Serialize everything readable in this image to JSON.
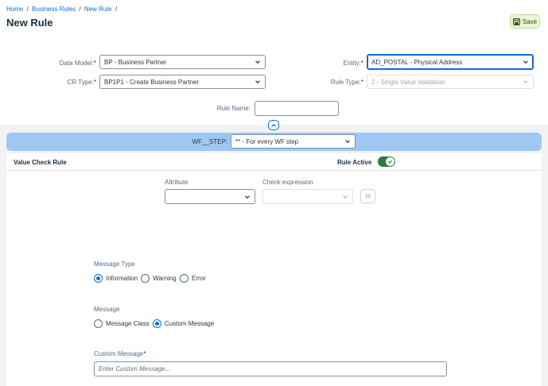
{
  "breadcrumb": {
    "home": "Home",
    "business_rules": "Business Rules",
    "new_rule": "New Rule",
    "sep": "/"
  },
  "page": {
    "title": "New Rule",
    "save_label": "Save"
  },
  "form": {
    "data_model": {
      "label": "Data Model:",
      "value": "BP - Business Partner"
    },
    "cr_type": {
      "label": "CR Type:",
      "value": "BP1P1 - Create Business Partner"
    },
    "entity": {
      "label": "Entity:",
      "value": "AD_POSTAL - Physical Address"
    },
    "rule_type": {
      "label": "Rule Type:",
      "value": "2 - Single Value Validation"
    },
    "rule_name": {
      "label": "Rule Name:",
      "value": ""
    },
    "required_mark": "*"
  },
  "wf_step": {
    "label": "WF__STEP:",
    "value": "** - For every WF step"
  },
  "rule_panel": {
    "title": "Value Check Rule",
    "rule_active_label": "Rule Active",
    "rule_active": true,
    "attribute_label": "Attribute",
    "attribute_value": "",
    "check_expression_label": "Check expression",
    "check_expression_value": "",
    "message_type": {
      "label": "Message Type",
      "options": [
        "Information",
        "Warning",
        "Error"
      ],
      "selected": "Information"
    },
    "message": {
      "label": "Message",
      "options": [
        "Message Class",
        "Custom Message"
      ],
      "selected": "Custom Message"
    },
    "custom_message": {
      "label": "Custom Message",
      "placeholder": "Enter Custom Message..."
    }
  },
  "colors": {
    "accent": "#0a6ed1",
    "wf_bar": "#9ec8f3",
    "toggle_on": "#2b7c3b",
    "required": "#bb0000"
  },
  "icons": {
    "save": "save-icon",
    "chevron": "chevron-down-icon",
    "collapse": "chevron-up-icon",
    "go": "double-chevron-right-icon",
    "check": "check-icon"
  }
}
